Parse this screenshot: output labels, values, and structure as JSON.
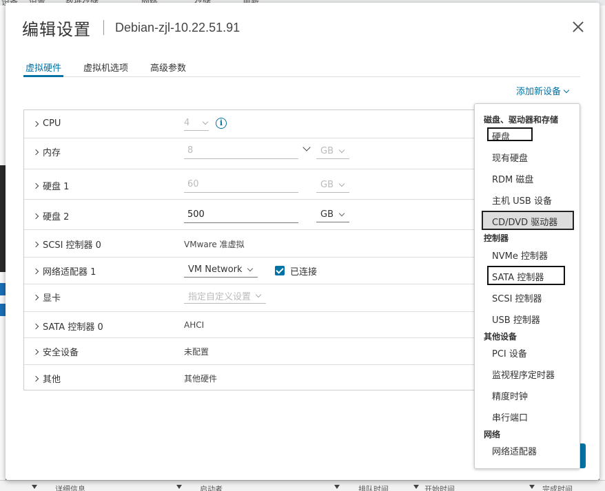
{
  "background": {
    "top_texts": [
      "设备",
      "设置",
      "数据存储",
      "网络",
      "存储",
      "更新"
    ],
    "bottom_texts": [
      "详细信息",
      "启动者",
      "排队时间",
      "开始时间",
      "完成时间"
    ]
  },
  "dialog": {
    "title": "编辑设置",
    "vm_name": "Debian-zjl-10.22.51.91",
    "tabs": [
      {
        "label": "虚拟硬件",
        "active": true
      },
      {
        "label": "虚拟机选项",
        "active": false
      },
      {
        "label": "高级参数",
        "active": false
      }
    ],
    "add_device_label": "添加新设备"
  },
  "hardware": {
    "cpu": {
      "label": "CPU",
      "value": "4"
    },
    "memory": {
      "label": "内存",
      "value": "8",
      "unit": "GB"
    },
    "disk1": {
      "label": "硬盘 1",
      "value": "60",
      "unit": "GB"
    },
    "disk2": {
      "label": "硬盘 2",
      "value": "500",
      "unit": "GB"
    },
    "scsi": {
      "label": "SCSI 控制器 0",
      "value": "VMware 准虚拟"
    },
    "net": {
      "label": "网络适配器 1",
      "value": "VM Network",
      "connected_label": "已连接"
    },
    "gpu": {
      "label": "显卡",
      "value": "指定自定义设置"
    },
    "sata": {
      "label": "SATA 控制器 0",
      "value": "AHCI"
    },
    "security": {
      "label": "安全设备",
      "value": "未配置"
    },
    "other": {
      "label": "其他",
      "value": "其他硬件"
    }
  },
  "menu": {
    "groups": [
      {
        "header": "磁盘、驱动器和存储",
        "items": [
          "硬盘",
          "现有硬盘",
          "RDM 磁盘",
          "主机 USB 设备",
          "CD/DVD 驱动器"
        ]
      },
      {
        "header": "控制器",
        "items": [
          "NVMe 控制器",
          "SATA 控制器",
          "SCSI 控制器",
          "USB 控制器"
        ]
      },
      {
        "header": "其他设备",
        "items": [
          "PCI 设备",
          "监视程序定时器",
          "精度时钟",
          "串行端口"
        ]
      },
      {
        "header": "网络",
        "items": [
          "网络适配器"
        ]
      }
    ]
  },
  "colors": {
    "accent": "#0072a3"
  }
}
